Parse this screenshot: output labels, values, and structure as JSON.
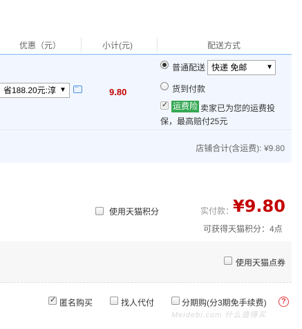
{
  "header": {
    "col_discount": "优惠（元）",
    "col_subtotal": "小计(元)",
    "col_shipping": "配送方式"
  },
  "order": {
    "discount_select_value": "省188.20元:淳",
    "subtotal": "9.80",
    "shipping": {
      "option_normal": "普通配送",
      "option_normal_checked": true,
      "method_select_value": "快递 免邮",
      "option_cod": "货到付款",
      "option_cod_checked": false,
      "insurance_badge": "运费险",
      "insurance_text_line1": "卖家已为您的运费投",
      "insurance_text_line2": "保，最高赔付25元"
    }
  },
  "store_total": "店铺合计(含运费): ¥9.80",
  "summary": {
    "use_points_label": "使用天猫积分",
    "actual_label": "实付款：",
    "actual_amount": "¥9.80",
    "points_earned": "可获得天猫积分：4点"
  },
  "coupon": {
    "use_coupon_label": "使用天猫点券"
  },
  "footer_options": {
    "anonymous_label": "匿名购买",
    "anonymous_checked": true,
    "proxy_pay_label": "找人代付",
    "installment_label": "分期购(分3期免手续费)"
  },
  "watermark_text": "Meidebi.com  什么值得买",
  "colors": {
    "price_red": "#c40000",
    "row_bg": "#f2f7ff",
    "header_border": "#b2d1ff",
    "insurance_green": "#35a853"
  }
}
